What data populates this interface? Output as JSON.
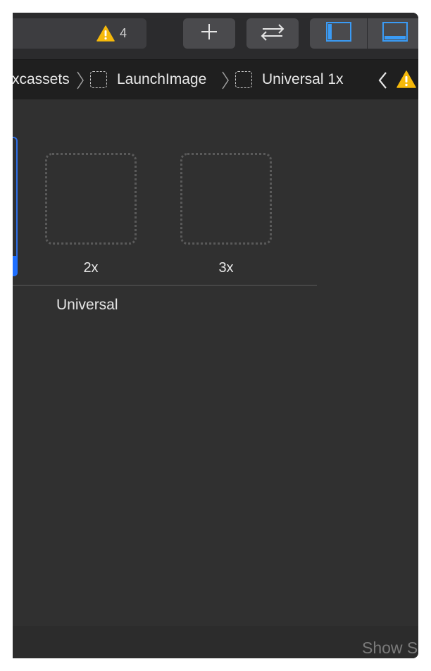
{
  "toolbar": {
    "warning_count": "4",
    "accent_color": "#3a9bf5",
    "warning_color": "#f6b90b"
  },
  "jumpbar": {
    "crumbs": [
      "xcassets",
      "LaunchImage",
      "Universal 1x"
    ]
  },
  "editor": {
    "wells": [
      {
        "label": "2x"
      },
      {
        "label": "3x"
      }
    ],
    "group_label": "Universal"
  },
  "footer": {
    "text": "Show S"
  }
}
